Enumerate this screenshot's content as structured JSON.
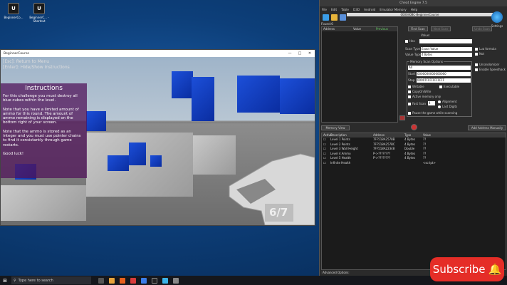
{
  "desktop": {
    "icons": [
      {
        "label": "BeginnerCo...",
        "glyph": "U"
      },
      {
        "label": "BeginnerC... - Shortcut",
        "glyph": "U"
      }
    ]
  },
  "game": {
    "window_title": "BeginnerCourse",
    "hint_line1": "[Esc]: Return to Menu",
    "hint_line2": "[Enter]: Hide/Show Instructions",
    "instructions_title": "Instructions",
    "instructions_p1": "For this challenge you must destroy all blue cubes within the level.",
    "instructions_p2": "Note that you have a limited amount of ammo for this round. The amount of ammo remaining is displayed on the bottom right of your screen.",
    "instructions_p3": "Note that the ammo is stored as an integer and you must use pointer chains to find it consistantly through game restarts.",
    "instructions_p4": "Good luck!",
    "ammo": "6/7"
  },
  "ce": {
    "title": "Cheat Engine 7.5",
    "menu": [
      "File",
      "Edit",
      "Table",
      "D3D",
      "Android",
      "Emulator Memory",
      "Help"
    ],
    "process": "000040BC-BeginnerCourse",
    "settings_label": "Settings",
    "found_label": "Found:0",
    "results_headers": [
      "Address",
      "Value",
      "Previous"
    ],
    "first_scan": "First Scan",
    "next_scan": "Next Scan",
    "undo_scan": "Undo Scan",
    "value_label": "Value:",
    "hex_label": "Hex",
    "scan_type_label": "Scan Type",
    "scan_type_value": "Exact Value",
    "value_type_label": "Value Type",
    "value_type_value": "4 Bytes",
    "lua_formula": "Lua formula",
    "not_label": "Not",
    "memory_scan_options": "Memory Scan Options",
    "all_value": "All",
    "start_label": "Start",
    "start_value": "0000000000000000",
    "stop_label": "Stop",
    "stop_value": "00007FFFFFFFFFFF",
    "writable": "Writable",
    "executable": "Executable",
    "copy_on_write": "CopyOnWrite",
    "active_memory": "Active memory only",
    "fast_scan": "Fast Scan",
    "fast_scan_value": "4",
    "alignment": "Alignment",
    "last_digits": "Last Digits",
    "pause_game": "Pause the game while scanning",
    "unrandomizer": "Unrandomizer",
    "speedhack": "Enable Speedhack",
    "memory_view": "Memory View",
    "add_address": "Add Address Manually",
    "table_headers": [
      "Active",
      "Description",
      "Address",
      "Type",
      "Value"
    ],
    "rows": [
      {
        "desc": "Level 1 Points",
        "addr": "7FF518A2578B",
        "type": "4 Bytes",
        "value": "??"
      },
      {
        "desc": "Level 2 Points",
        "addr": "7FF518A257BC",
        "type": "4 Bytes",
        "value": "??"
      },
      {
        "desc": "Level 3 Wall Height",
        "addr": "7FF518A22348",
        "type": "Double",
        "value": "??"
      },
      {
        "desc": "Level 4 Ammo",
        "addr": "P->????????",
        "type": "4 Bytes",
        "value": "??"
      },
      {
        "desc": "Level 5 Health",
        "addr": "P->????????",
        "type": "4 Bytes",
        "value": "??"
      },
      {
        "desc": "Infinite Health",
        "addr": "",
        "type": "",
        "value": "<script>"
      }
    ],
    "advanced_options": "Advanced Options"
  },
  "taskbar": {
    "search_placeholder": "Type here to search"
  },
  "subscribe": {
    "label": "Subscribe"
  }
}
